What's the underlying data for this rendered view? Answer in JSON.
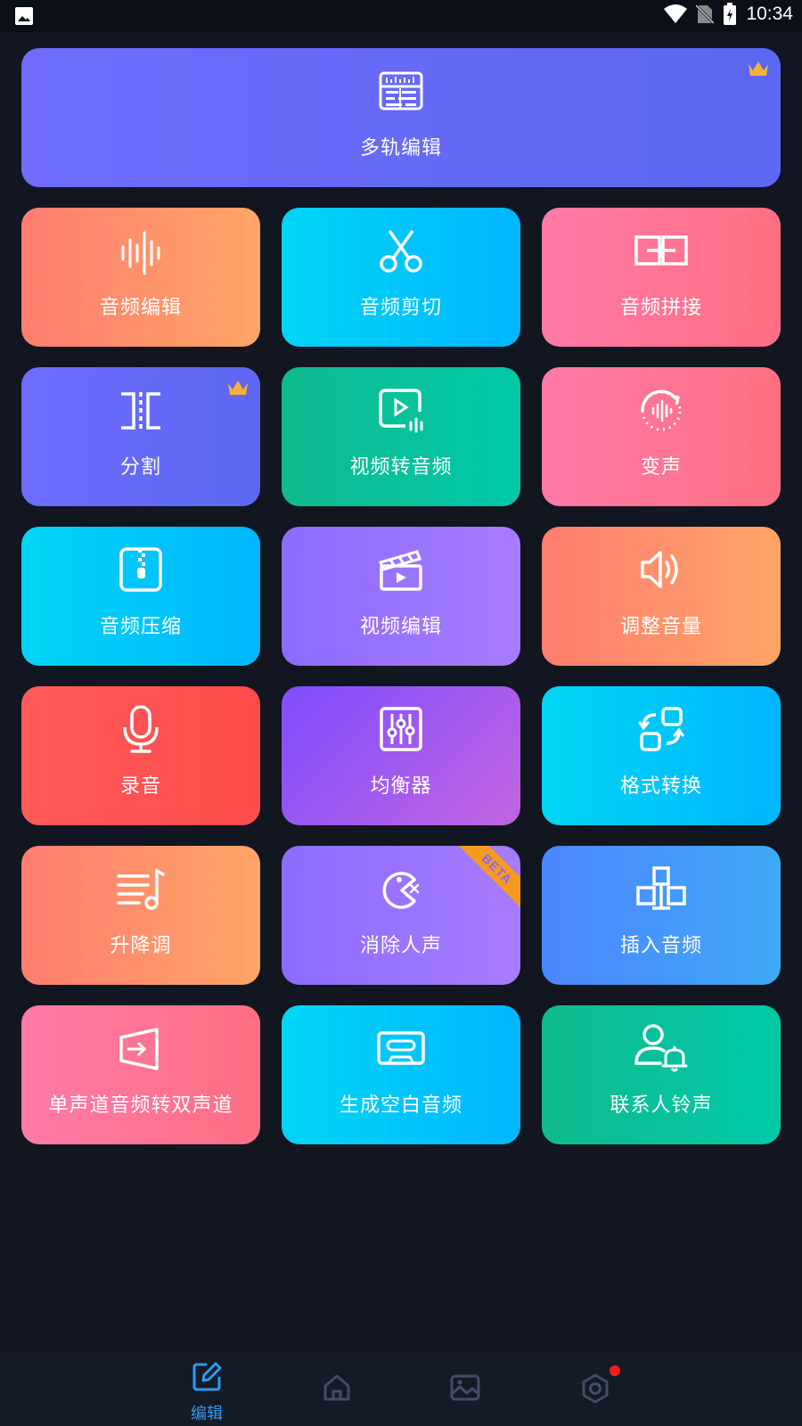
{
  "status_bar": {
    "time": "10:34"
  },
  "multi_track": {
    "label": "多轨编辑"
  },
  "tools": [
    {
      "label": "音频编辑",
      "icon": "waveform-icon"
    },
    {
      "label": "音频剪切",
      "icon": "scissors-icon"
    },
    {
      "label": "音频拼接",
      "icon": "join-icon"
    },
    {
      "label": "分割",
      "icon": "split-icon"
    },
    {
      "label": "视频转音频",
      "icon": "video-to-audio-icon"
    },
    {
      "label": "变声",
      "icon": "voice-change-icon"
    },
    {
      "label": "音频压缩",
      "icon": "zip-icon"
    },
    {
      "label": "视频编辑",
      "icon": "clapperboard-icon"
    },
    {
      "label": "调整音量",
      "icon": "speaker-icon"
    },
    {
      "label": "录音",
      "icon": "microphone-icon"
    },
    {
      "label": "均衡器",
      "icon": "equalizer-icon"
    },
    {
      "label": "格式转换",
      "icon": "format-convert-icon"
    },
    {
      "label": "升降调",
      "icon": "pitch-icon"
    },
    {
      "label": "消除人声",
      "icon": "vocal-remove-icon",
      "badge": "BETA"
    },
    {
      "label": "插入音频",
      "icon": "insert-icon"
    },
    {
      "label": "单声道音频转双声道",
      "icon": "mono-to-stereo-icon"
    },
    {
      "label": "生成空白音频",
      "icon": "cassette-icon"
    },
    {
      "label": "联系人铃声",
      "icon": "contact-ringtone-icon"
    }
  ],
  "bottom_nav": {
    "items": [
      {
        "label": "编辑",
        "icon": "edit-icon",
        "active": true
      },
      {
        "icon": "home-icon"
      },
      {
        "icon": "gallery-icon"
      },
      {
        "icon": "settings-icon"
      }
    ]
  },
  "colors": {
    "active": "#2b9bf4",
    "background": "#111620",
    "premium_crown": "#f5b23a"
  }
}
